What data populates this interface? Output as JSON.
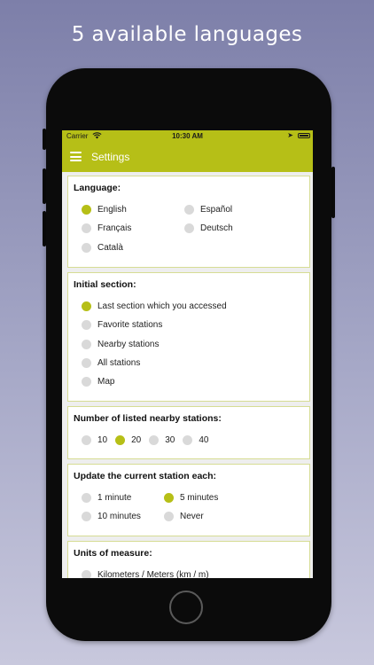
{
  "headline": "5 available languages",
  "status_bar": {
    "carrier": "Carrier",
    "time": "10:30 AM"
  },
  "navbar": {
    "title": "Settings"
  },
  "accent_color": "#b6bf17",
  "sections": {
    "language": {
      "title": "Language:",
      "options": [
        "English",
        "Español",
        "Français",
        "Deutsch",
        "Català"
      ],
      "selected": "English"
    },
    "initial_section": {
      "title": "Initial section:",
      "options": [
        "Last section which you accessed",
        "Favorite stations",
        "Nearby stations",
        "All stations",
        "Map"
      ],
      "selected": "Last section which you accessed"
    },
    "nearby_count": {
      "title": "Number of listed nearby stations:",
      "options": [
        "10",
        "20",
        "30",
        "40"
      ],
      "selected": "20"
    },
    "update_interval": {
      "title": "Update the current station each:",
      "options": [
        "1 minute",
        "5 minutes",
        "10 minutes",
        "Never"
      ],
      "selected": "5 minutes"
    },
    "units": {
      "title": "Units of measure:",
      "options": [
        "Kilometers / Meters (km / m)"
      ]
    }
  }
}
